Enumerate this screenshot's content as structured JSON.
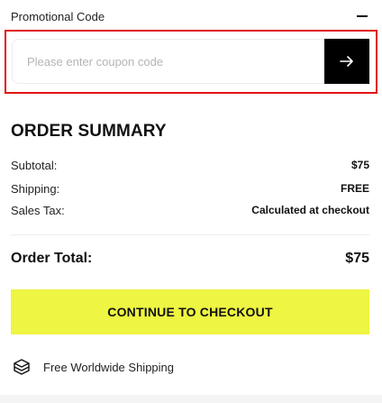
{
  "promo": {
    "title": "Promotional Code",
    "input_placeholder": "Please enter coupon code",
    "input_value": ""
  },
  "summary": {
    "title": "ORDER SUMMARY",
    "subtotal_label": "Subtotal:",
    "subtotal_value": "$75",
    "shipping_label": "Shipping:",
    "shipping_value": "FREE",
    "tax_label": "Sales Tax:",
    "tax_value": "Calculated at checkout",
    "total_label": "Order Total:",
    "total_value": "$75"
  },
  "checkout": {
    "button_label": "CONTINUE TO CHECKOUT"
  },
  "shipping_note": {
    "text": "Free Worldwide Shipping",
    "icon": "box-icon"
  },
  "colors": {
    "accent": "#eef542",
    "apply_button": "#000000",
    "highlight": "#e11414"
  }
}
